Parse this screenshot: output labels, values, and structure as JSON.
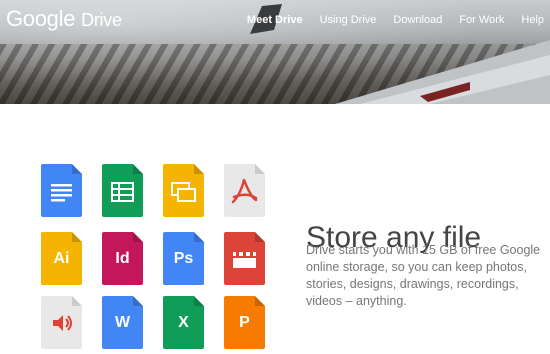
{
  "brand": {
    "logo_text": "Google",
    "product": "Drive"
  },
  "nav": {
    "items": [
      {
        "label": "Meet Drive",
        "active": true
      },
      {
        "label": "Using Drive",
        "active": false
      },
      {
        "label": "Download",
        "active": false
      },
      {
        "label": "For Work",
        "active": false
      },
      {
        "label": "Help",
        "active": false
      }
    ]
  },
  "feature": {
    "headline": "Store any file",
    "description": "Drive starts you with 15 GB of free Google online storage, so you can keep photos, stories, designs, drawings, recordings, videos – anything."
  },
  "file_icons": [
    {
      "name": "docs-icon",
      "color": "#4285f4",
      "label": ""
    },
    {
      "name": "sheets-icon",
      "color": "#0f9d58",
      "label": ""
    },
    {
      "name": "slides-icon",
      "color": "#f4b400",
      "label": ""
    },
    {
      "name": "pdf-icon",
      "color": "#e8e8e8",
      "label": ""
    },
    {
      "name": "illustrator-icon",
      "color": "#f4b400",
      "label": "Ai"
    },
    {
      "name": "indesign-icon",
      "color": "#c2185b",
      "label": "Id"
    },
    {
      "name": "photoshop-icon",
      "color": "#4285f4",
      "label": "Ps"
    },
    {
      "name": "video-icon",
      "color": "#db4437",
      "label": ""
    },
    {
      "name": "audio-icon",
      "color": "#e8e8e8",
      "label": ""
    },
    {
      "name": "word-icon",
      "color": "#4285f4",
      "label": "W"
    },
    {
      "name": "excel-icon",
      "color": "#0f9d58",
      "label": "X"
    },
    {
      "name": "powerpoint-icon",
      "color": "#f57c00",
      "label": "P"
    }
  ]
}
